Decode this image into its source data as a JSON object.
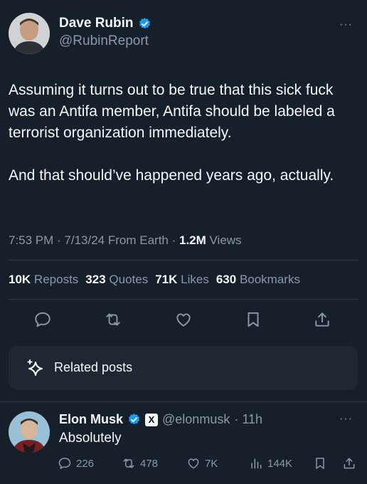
{
  "tweet": {
    "author_name": "Dave Rubin",
    "author_handle": "@RubinReport",
    "text_p1": "Assuming it turns out to be true that this sick fuck was an Antifa member, Antifa should be labeled a terrorist organization immediately.",
    "text_p2": "And that should’ve happened years ago, actually.",
    "time": "7:53 PM · 7/13/24 From Earth · ",
    "views_count": "1.2M",
    "views_label": " Views",
    "more": "···"
  },
  "stats": {
    "reposts_count": "10K",
    "reposts_label": "Reposts",
    "quotes_count": "323",
    "quotes_label": "Quotes",
    "likes_count": "71K",
    "likes_label": "Likes",
    "bookmarks_count": "630",
    "bookmarks_label": "Bookmarks"
  },
  "related": {
    "label": "Related posts",
    "icon": "sparkle-icon"
  },
  "reply": {
    "author_name": "Elon Musk",
    "author_handle": "@elonmusk",
    "time": "· 11h",
    "text": "Absolutely",
    "badge": "X",
    "more": "···",
    "replies": "226",
    "reposts": "478",
    "likes": "7K",
    "views": "144K"
  },
  "colors": {
    "background": "#15202b",
    "verified": "#1d9bf0",
    "muted": "#8b98a5",
    "text": "#f7f9f9"
  }
}
